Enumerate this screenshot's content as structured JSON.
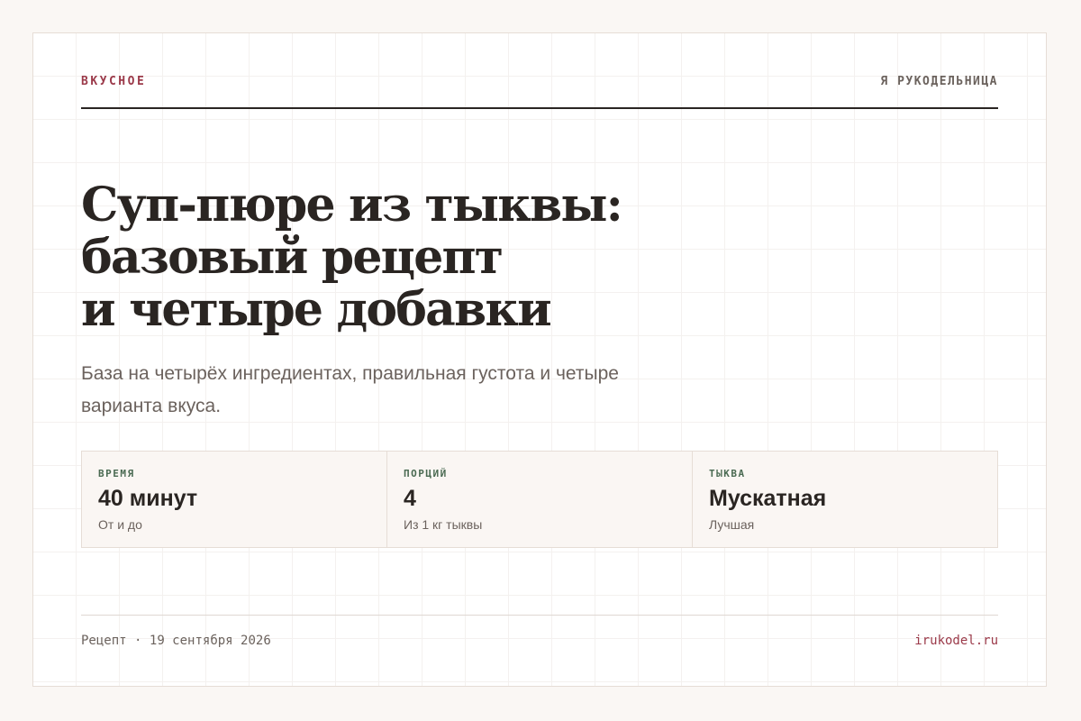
{
  "header": {
    "brand": "ВКУСНОЕ",
    "site_name": "Я РУКОДЕЛЬНИЦА"
  },
  "article": {
    "title_lines": [
      "Суп-пюре из тыквы:",
      "базовый рецепт",
      "и четыре добавки"
    ],
    "subtitle": "База на четырёх ингредиентах, правильная густота и четыре варианта вкуса."
  },
  "stats": [
    {
      "label": "ВРЕМЯ",
      "value": "40 минут",
      "note": "От и до"
    },
    {
      "label": "ПОРЦИЙ",
      "value": "4",
      "note": "Из 1 кг тыквы"
    },
    {
      "label": "ТЫКВА",
      "value": "Мускатная",
      "note": "Лучшая"
    }
  ],
  "footer": {
    "category": "Рецепт",
    "separator": "·",
    "date": "19 сентября 2026",
    "domain": "irukodel.ru"
  },
  "colors": {
    "accent": "#9b3a4a",
    "label_green": "#4a6a52",
    "text_dark": "#2a2522",
    "text_muted": "#6b625d",
    "page_bg": "#faf7f4",
    "panel_bg": "#faf6f3",
    "border": "#e6ddd6"
  }
}
